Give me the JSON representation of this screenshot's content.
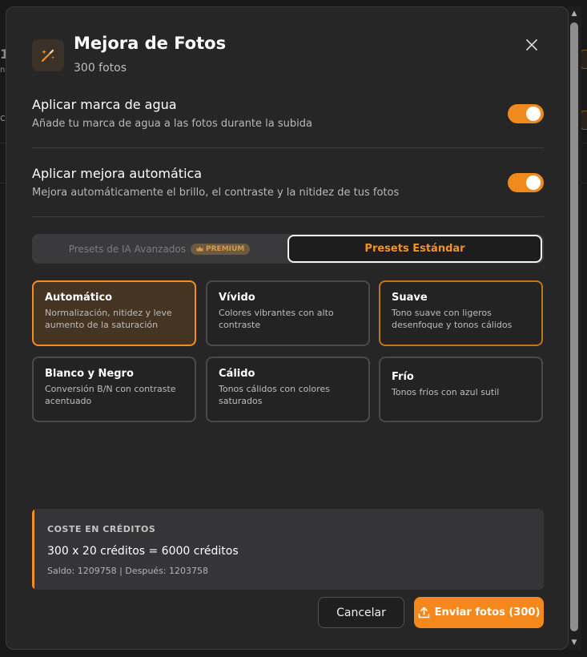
{
  "dialog": {
    "title": "Mejora de Fotos",
    "subtitle": "300 fotos"
  },
  "options": {
    "watermark": {
      "title": "Aplicar marca de agua",
      "description": "Añade tu marca de agua a las fotos durante la subida",
      "enabled": true
    },
    "auto_enhance": {
      "title": "Aplicar mejora automática",
      "description": "Mejora automáticamente el brillo, el contraste y la nitidez de tus fotos",
      "enabled": true
    }
  },
  "tabs": {
    "ai": "Presets de IA Avanzados",
    "premium_badge": "PREMIUM",
    "standard": "Presets Estándar",
    "active": "standard"
  },
  "presets": [
    {
      "title": "Automático",
      "description": "Normalización, nitidez y leve aumento de la saturación",
      "selected": true
    },
    {
      "title": "Vívido",
      "description": "Colores vibrantes con alto contraste",
      "selected": false
    },
    {
      "title": "Suave",
      "description": "Tono suave con ligeros desenfoque y tonos cálidos",
      "selected": false
    },
    {
      "title": "Blanco y Negro",
      "description": "Conversión B/N con contraste acentuado",
      "selected": false
    },
    {
      "title": "Cálido",
      "description": "Tonos cálidos con colores saturados",
      "selected": false
    },
    {
      "title": "Frío",
      "description": "Tonos fríos con azul sutil",
      "selected": false
    }
  ],
  "cost": {
    "label": "COSTE EN CRÉDITOS",
    "calculation": "300 x 20 créditos = 6000 créditos",
    "balance": "Saldo: 1209758 | Después: 1203758"
  },
  "buttons": {
    "cancel": "Cancelar",
    "send": "Enviar fotos (300)"
  },
  "colors": {
    "accent": "#f5881c",
    "background": "#262627"
  },
  "icons": {
    "header": "magic-wand-icon",
    "close": "close-icon",
    "premium": "crown-icon",
    "send": "upload-icon"
  }
}
